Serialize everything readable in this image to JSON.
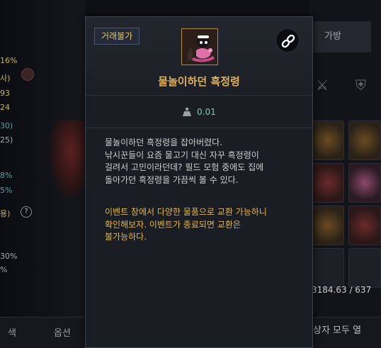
{
  "background": {
    "left_stats": [
      "16%",
      "사)",
      "93",
      "24",
      "30)",
      "25)",
      "8%",
      "5%",
      "용)",
      "30%",
      "%"
    ],
    "help_icon": "?",
    "bag_tab_label": "가방",
    "currency_text": "3184.63 / 637",
    "bottom_buttons": [
      "색",
      "옵션"
    ],
    "box_button_label": "상자 모두 열"
  },
  "tooltip": {
    "trade_badge": "거래불가",
    "item_name": "물놀이하던 흑정령",
    "weight": "0.01",
    "description_lines": [
      "물놀이하던 흑정령을 잡아버렸다.",
      "낚시꾼들이 요즘 물고기 대신 자꾸 흑정령이",
      "걸려서 고민이라던데? 필드 모험 중에도 집에",
      "돌아가던 흑정령을 가끔씩 볼 수 있다."
    ],
    "notice_lines": [
      "이벤트 창에서 다양한 물품으로 교환 가능하니",
      "확인해보자. 이벤트가 종료되면 교환은",
      "불가능하다."
    ],
    "icons": {
      "link": "link-icon",
      "weight": "weight-icon"
    }
  },
  "colors": {
    "item_name": "#e0b15a",
    "weight_value": "#6fd0c0",
    "notice": "#e4b646",
    "trade_badge_text": "#e2c46a"
  }
}
